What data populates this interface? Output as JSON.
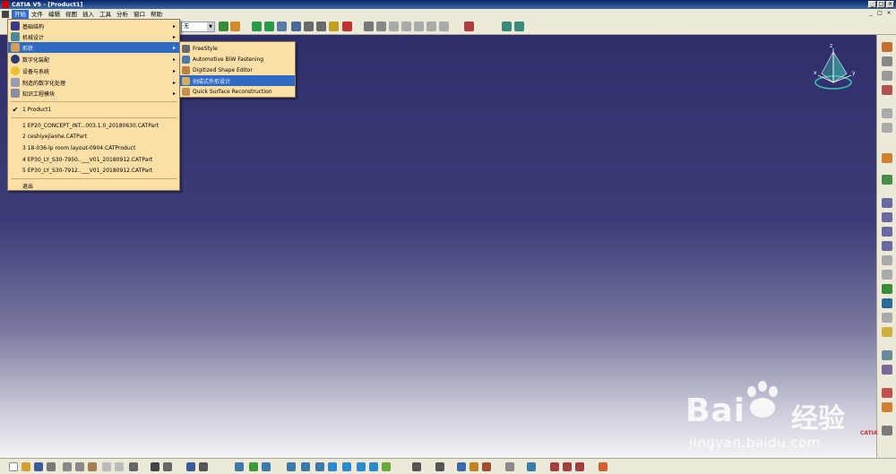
{
  "window": {
    "title": "CATIA V5 - [Product1]",
    "controls": [
      "_",
      "□",
      "×"
    ]
  },
  "menubar": {
    "items": [
      "开始",
      "文件",
      "编辑",
      "视图",
      "插入",
      "工具",
      "分析",
      "窗口",
      "帮助"
    ],
    "active": "开始",
    "mdi_controls": [
      "_",
      "□",
      "×"
    ]
  },
  "toolbar": {
    "combo_value": "无"
  },
  "start_menu": {
    "items": [
      {
        "label": "基础结构",
        "submenu": "▸"
      },
      {
        "label": "机械设计",
        "submenu": "▸"
      },
      {
        "label": "形状",
        "submenu": "▸"
      },
      {
        "label": "数字化装配",
        "submenu": "▸"
      },
      {
        "label": "设备与系统",
        "submenu": "▸"
      },
      {
        "label": "制造的数字化处理",
        "submenu": "▸"
      },
      {
        "label": "知识工程模块",
        "submenu": "▸"
      }
    ],
    "highlighted_index": 2,
    "open_document": {
      "check": "✔",
      "label": "1 Product1"
    },
    "recent_files": [
      "1 EP20_CONCEPT_INT...003.1.0_20180630.CATPart",
      "2 ceshiyejiaohe.CATPart",
      "3 18-036-lp room layout-0904.CATProduct",
      "4 EP30_LY_S30-7950..___V01_20180912.CATPart",
      "5 EP30_LY_S30-7912..___V01_20180912.CATPart"
    ],
    "exit_label": "退出"
  },
  "shape_submenu": {
    "items": [
      {
        "label": "FreeStyle",
        "icon": "freestyle-icon"
      },
      {
        "label": "Automotive BiW Fastening",
        "icon": "biw-fastening-icon"
      },
      {
        "label": "Digitized Shape Editor",
        "icon": "digitized-shape-icon"
      },
      {
        "label": "创成式外形设计",
        "icon": "gsd-icon"
      },
      {
        "label": "Quick Surface Reconstruction",
        "icon": "qsr-icon"
      }
    ],
    "highlighted_index": 3
  },
  "compass": {
    "x_label": "x",
    "y_label": "y",
    "z_label": "z"
  },
  "watermark": {
    "brand": "Bai",
    "brand_suffix": "经验",
    "url": "jingyan.baidu.com"
  },
  "logo_text": "CATIA",
  "colors": {
    "menu_bg": "#fcdfa6",
    "highlight": "#316ac5",
    "viewport_top": "#2e2e6b",
    "viewport_bottom": "#f4f4f6"
  }
}
